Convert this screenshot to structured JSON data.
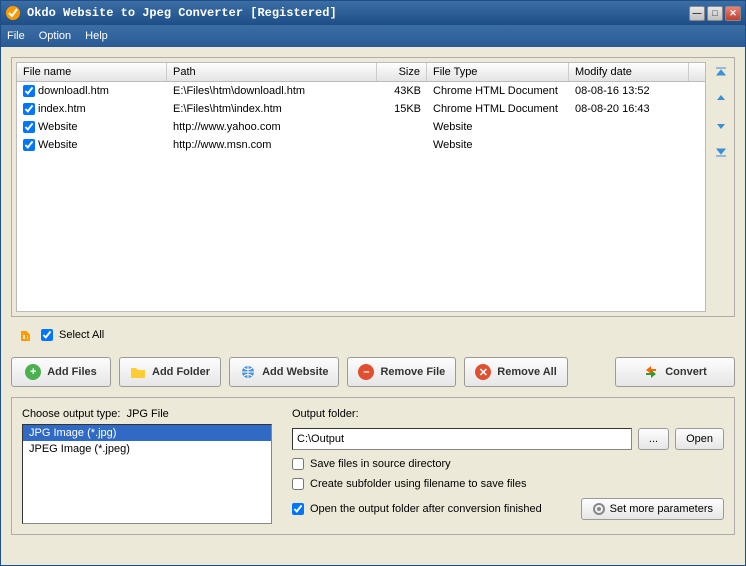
{
  "title": "Okdo Website to Jpeg Converter [Registered]",
  "menu": {
    "file": "File",
    "option": "Option",
    "help": "Help"
  },
  "columns": {
    "name": "File name",
    "path": "Path",
    "size": "Size",
    "type": "File Type",
    "date": "Modify date"
  },
  "rows": [
    {
      "name": "downloadl.htm",
      "path": "E:\\Files\\htm\\downloadl.htm",
      "size": "43KB",
      "type": "Chrome HTML Document",
      "date": "08-08-16 13:52"
    },
    {
      "name": "index.htm",
      "path": "E:\\Files\\htm\\index.htm",
      "size": "15KB",
      "type": "Chrome HTML Document",
      "date": "08-08-20 16:43"
    },
    {
      "name": "Website",
      "path": "http://www.yahoo.com",
      "size": "",
      "type": "Website",
      "date": ""
    },
    {
      "name": "Website",
      "path": "http://www.msn.com",
      "size": "",
      "type": "Website",
      "date": ""
    }
  ],
  "selectAll": "Select All",
  "buttons": {
    "addFiles": "Add Files",
    "addFolder": "Add Folder",
    "addWebsite": "Add Website",
    "removeFile": "Remove File",
    "removeAll": "Remove All",
    "convert": "Convert"
  },
  "output": {
    "chooseLabel": "Choose output type:",
    "chooseValue": "JPG File",
    "options": [
      "JPG Image (*.jpg)",
      "JPEG Image (*.jpeg)"
    ],
    "folderLabel": "Output folder:",
    "folderValue": "C:\\Output",
    "browse": "...",
    "open": "Open",
    "saveSource": "Save files in source directory",
    "createSub": "Create subfolder using filename to save files",
    "openAfter": "Open the output folder after conversion finished",
    "setMore": "Set more parameters"
  }
}
